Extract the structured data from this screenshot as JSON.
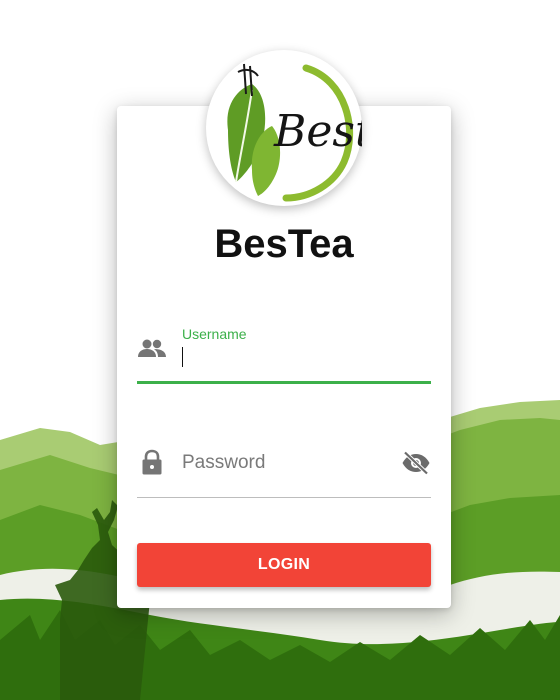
{
  "app": {
    "title": "BesTea",
    "logo_text": "Bestea"
  },
  "form": {
    "username": {
      "label": "Username",
      "value": "",
      "icon": "people-icon",
      "focused": true
    },
    "password": {
      "placeholder": "Password",
      "value": "",
      "icon": "lock-icon",
      "toggle_icon": "eye-off-icon"
    },
    "login_label": "LOGIN"
  },
  "colors": {
    "accent_green": "#3cb04a",
    "button_red": "#f24437",
    "title_text": "#111111"
  }
}
